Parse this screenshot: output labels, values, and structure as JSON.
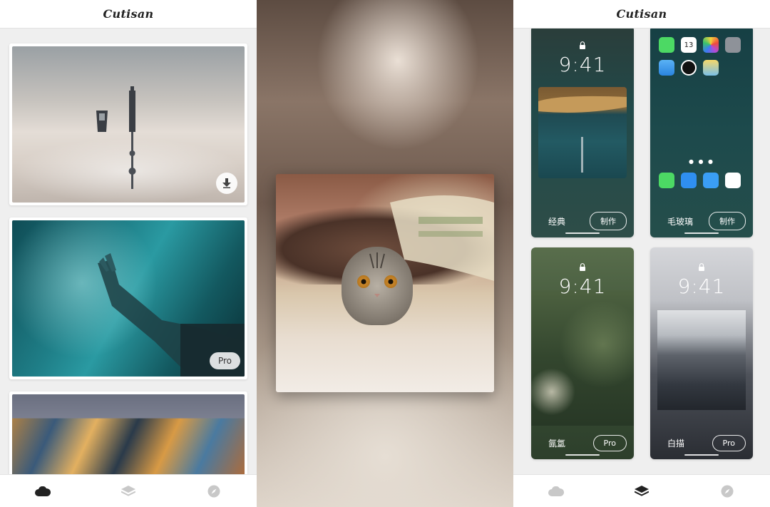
{
  "app": {
    "logo": "Cutisan"
  },
  "left_screen": {
    "cards": [
      {
        "image": "city-above-clouds",
        "action_icon": "download-icon"
      },
      {
        "image": "hand-on-water",
        "badge": "Pro"
      },
      {
        "image": "iridescent-foil"
      }
    ],
    "tabbar": {
      "active": "cloud-icon",
      "items": [
        "cloud-icon",
        "layers-icon",
        "compass-icon"
      ]
    }
  },
  "middle_screen": {
    "photo": "cat-under-blanket"
  },
  "right_screen": {
    "tiles": [
      {
        "time": "9:41",
        "label": "经典",
        "button": "制作",
        "style": "lockscreen"
      },
      {
        "label": "毛玻璃",
        "button": "制作",
        "style": "homescreen",
        "date_icon_number": "13"
      },
      {
        "time": "9:41",
        "label": "氤氲",
        "button": "Pro",
        "style": "lockscreen"
      },
      {
        "time": "9:41",
        "label": "白描",
        "button": "Pro",
        "style": "lockscreen"
      }
    ],
    "tabbar": {
      "active": "layers-icon",
      "items": [
        "cloud-icon",
        "layers-icon",
        "compass-icon"
      ]
    }
  },
  "colors": {
    "active_tab": "#222222",
    "inactive_tab": "#c8c8c8"
  }
}
